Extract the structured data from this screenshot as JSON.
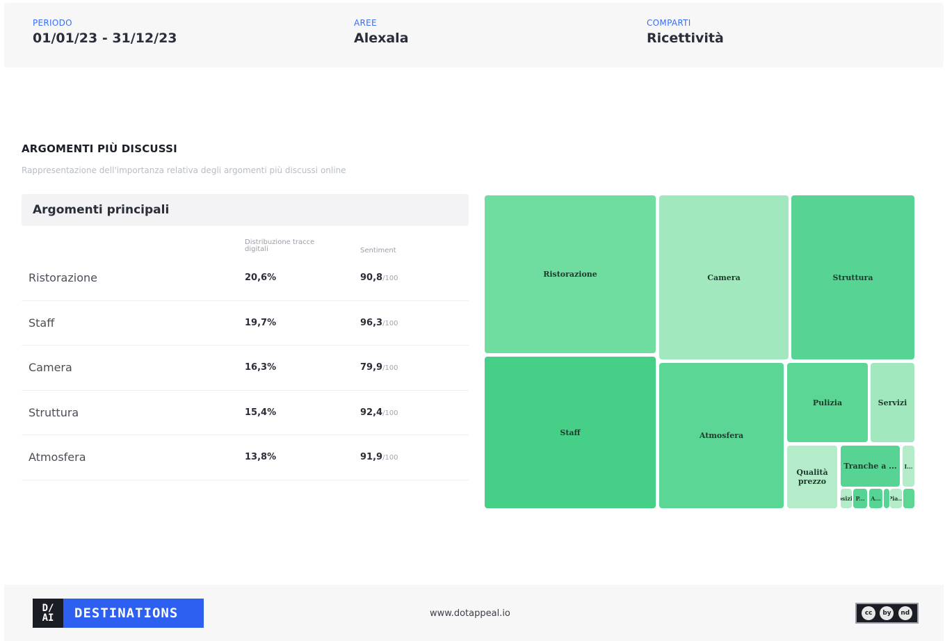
{
  "filters": {
    "periodo": {
      "label": "PERIODO",
      "value": "01/01/23 - 31/12/23"
    },
    "aree": {
      "label": "AREE",
      "value": "Alexala"
    },
    "comparti": {
      "label": "COMPARTI",
      "value": "Ricettività"
    }
  },
  "section": {
    "title": "ARGOMENTI PIÙ DISCUSSI",
    "subtitle": "Rappresentazione dell'importanza relativa degli argomenti più discussi online"
  },
  "table": {
    "title": "Argomenti principali",
    "col_distribution": "Distribuzione tracce digitali",
    "col_sentiment": "Sentiment",
    "sentiment_suffix": "/100",
    "rows": [
      {
        "name": "Ristorazione",
        "distribution": "20,6%",
        "sentiment": "90,8"
      },
      {
        "name": "Staff",
        "distribution": "19,7%",
        "sentiment": "96,3"
      },
      {
        "name": "Camera",
        "distribution": "16,3%",
        "sentiment": "79,9"
      },
      {
        "name": "Struttura",
        "distribution": "15,4%",
        "sentiment": "92,4"
      },
      {
        "name": "Atmosfera",
        "distribution": "13,8%",
        "sentiment": "91,9"
      }
    ]
  },
  "treemap": {
    "tiles": [
      {
        "label": "Ristorazione",
        "shade": "c1"
      },
      {
        "label": "Camera",
        "shade": "c2"
      },
      {
        "label": "Struttura",
        "shade": "c3"
      },
      {
        "label": "Staff",
        "shade": "c4"
      },
      {
        "label": "Atmosfera",
        "shade": "c5"
      },
      {
        "label": "Pulizia",
        "shade": "c5"
      },
      {
        "label": "Servizi",
        "shade": "c2"
      },
      {
        "label": "Qualità prezzo",
        "shade": "c6"
      },
      {
        "label": "Tranche a ...",
        "shade": "c3"
      },
      {
        "label": "I...",
        "shade": "c6"
      },
      {
        "label": "P...",
        "shade": "c3"
      },
      {
        "label": "Posizi...",
        "shade": "c6"
      },
      {
        "label": "A...",
        "shade": "c3"
      },
      {
        "label": "Pia...",
        "shade": "c6"
      },
      {
        "label": "",
        "shade": "c3"
      },
      {
        "label": "",
        "shade": "c5"
      }
    ]
  },
  "footer": {
    "logo_mark_top": "D/",
    "logo_mark_bottom": "AI",
    "logo_text": "DESTINATIONS",
    "website": "www.dotappeal.io",
    "license": [
      "cc",
      "by",
      "nd"
    ]
  }
}
